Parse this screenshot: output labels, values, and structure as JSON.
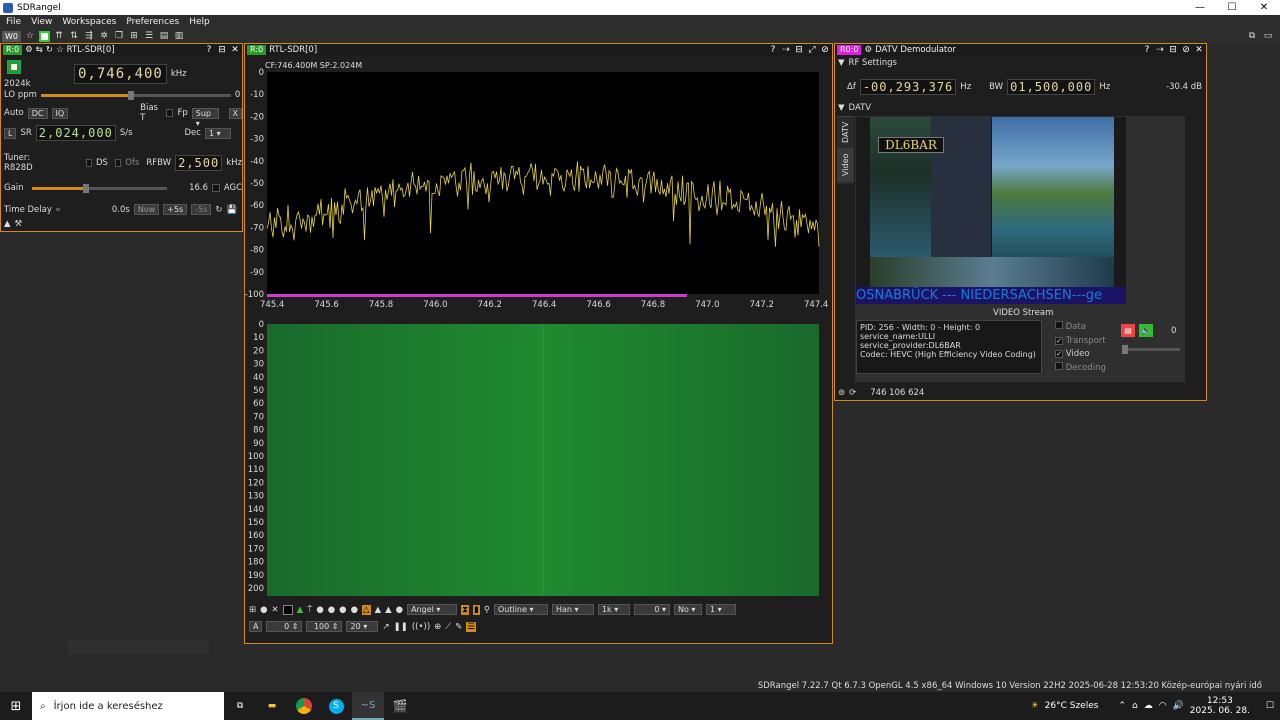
{
  "window": {
    "title": "SDRangel",
    "minimize": "—",
    "maximize": "☐",
    "close": "✕"
  },
  "menu": [
    "File",
    "View",
    "Workspaces",
    "Preferences",
    "Help"
  ],
  "toolbar": {
    "workspace_label": "W0"
  },
  "device_panel": {
    "badge": "R:0",
    "title": "RTL-SDR[0]",
    "sample_rate_label": "2024k",
    "frequency": "0,746,400",
    "frequency_unit": "kHz",
    "lo_ppm_label": "LO ppm",
    "lo_ppm_value": "0",
    "auto_label": "Auto",
    "dc_label": "DC",
    "iq_label": "IQ",
    "bias_t_label": "Bias T",
    "fp_label": "Fp",
    "sup_label": "Sup",
    "x_label": "X",
    "l_label": "L",
    "sr_label": "SR",
    "sr_value": "2,024,000",
    "sr_unit": "S/s",
    "dec_label": "Dec",
    "dec_value": "1",
    "tuner_label": "Tuner: R828D",
    "ds_label": "DS",
    "ofs_label": "Ofs",
    "rfbw_label": "RFBW",
    "rfbw_value": "2,500",
    "rfbw_unit": "kHz",
    "gain_label": "Gain",
    "gain_value": "16.6",
    "agc_label": "AGC",
    "time_delay_label": "Time Delay",
    "time_delay_value": "0.0s",
    "now_label": "Now",
    "plus5_label": "+5s",
    "minus5_label": "-5s"
  },
  "spectrum_panel": {
    "badge": "R:0",
    "title": "RTL-SDR[0]",
    "info": "CF:746.400M SP:2.024M",
    "y_ticks": [
      "0",
      "-10",
      "-20",
      "-30",
      "-40",
      "-50",
      "-60",
      "-70",
      "-80",
      "-90",
      "-100"
    ],
    "x_ticks": [
      "745.4",
      "745.6",
      "745.8",
      "746.0",
      "746.2",
      "746.4",
      "746.6",
      "746.8",
      "747.0",
      "747.2",
      "747.4"
    ],
    "wf_ticks": [
      "0",
      "10",
      "20",
      "30",
      "40",
      "50",
      "60",
      "70",
      "80",
      "90",
      "100",
      "110",
      "120",
      "130",
      "140",
      "150",
      "160",
      "170",
      "180",
      "190",
      "200"
    ],
    "ctl": {
      "palette": "Angel",
      "mode": "Outline",
      "window": "Han",
      "fft_size": "1k",
      "overlap": "0",
      "avg_mode": "No",
      "avg": "1",
      "a_label": "A",
      "ref_level": "0",
      "range": "100",
      "decay": "20"
    },
    "trace_color": "#e6d24a"
  },
  "datv_panel": {
    "badge": "R0:0",
    "title": "DATV Demodulator",
    "rf_settings_label": "RF Settings",
    "df_label": "Δf",
    "df_value": "-00,293,376",
    "hz_label": "Hz",
    "bw_label": "BW",
    "bw_value": "01,500,000",
    "bw_unit": "Hz",
    "level": "-30.4 dB",
    "datv_label": "DATV",
    "tab_datv": "DATV",
    "tab_video": "Video",
    "video_callsign": "DL6BAR",
    "video_ticker": "OSNABRÜCK --- NIEDERSACHSEN---ge",
    "video_stream_label": "VIDEO Stream",
    "info_lines": [
      "PID: 256 - Width: 0 - Height: 0",
      "service_name:ULLI",
      "service_provider:DL6BAR",
      "Codec: HEVC (High Efficiency Video Coding)"
    ],
    "data_label": "Data",
    "transport_label": "Transport",
    "video_label": "Video",
    "decoding_label": "Decoding",
    "audio_volume": "0",
    "footer_freq": "746 106 624"
  },
  "status_bar": "SDRangel 7.22.7 Qt 6.7.3 OpenGL 4.5 x86_64 Windows 10 Version 22H2  2025-06-28 12:53:20 Közép-európai nyári idő",
  "taskbar": {
    "search_placeholder": "Írjon ide a kereséshez",
    "weather": "26°C  Szeles",
    "time": "12:53",
    "date": "2025. 06. 28."
  }
}
